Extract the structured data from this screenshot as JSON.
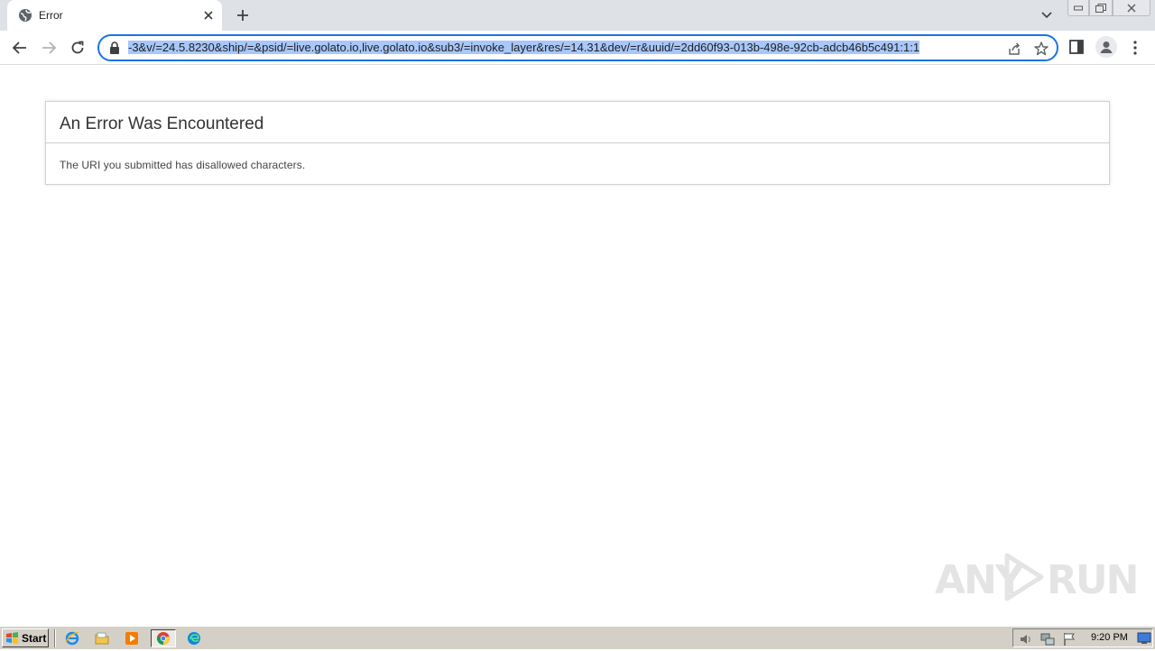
{
  "browser": {
    "tab": {
      "title": "Error",
      "favicon": "globe-icon"
    },
    "url_visible": "-3&v/=24.5.8230&ship/=&psid/=live.golato.io,live.golato.io&sub3/=invoke_layer&res/=14.31&dev/=r&uuid/=2dd60f93-013b-498e-92cb-adcb46b5c491:1:1",
    "colors": {
      "accent": "#1a73e8",
      "selection": "#a8c7fa",
      "tabstrip": "#dee1e6"
    }
  },
  "page": {
    "heading": "An Error Was Encountered",
    "message": "The URI you submitted has disallowed characters."
  },
  "watermark": {
    "left": "ANY",
    "right": "RUN"
  },
  "taskbar": {
    "start_label": "Start",
    "clock": "9:20 PM",
    "pinned": [
      "internet-explorer-icon",
      "folder-icon",
      "media-player-icon",
      "chrome-icon",
      "edge-icon"
    ]
  }
}
